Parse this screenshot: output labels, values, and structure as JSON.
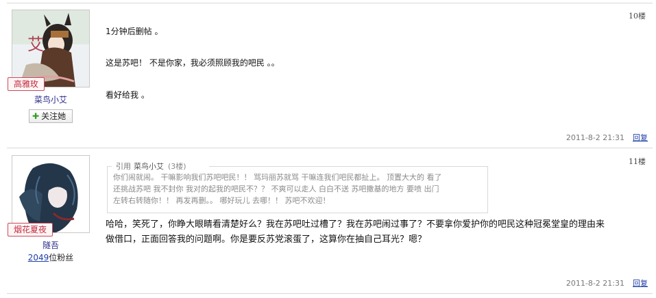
{
  "posts": [
    {
      "floor": "10楼",
      "user": {
        "name": "菜鸟小艾",
        "rank_badge": "高雅玫",
        "avatar_char": "艾",
        "follow_label": "关注她"
      },
      "content": {
        "lines": [
          "1分钟后删帖 。",
          "这是苏吧！ 不是你家，我必须照顾我的吧民 。。",
          "看好给我 。"
        ]
      },
      "time": "2011-8-2 21:31",
      "reply_label": "回复"
    },
    {
      "floor": "11楼",
      "user": {
        "name": "隧吾",
        "rank_badge": "烟花夏夜",
        "fans_count": "2049",
        "fans_suffix": "位粉丝"
      },
      "quote": {
        "prefix": "引用",
        "author": "菜鸟小艾",
        "floor": "(3楼)",
        "lines": [
          "你们闹就闹。 干嘛影响我们苏吧吧民！！ 骂玛丽苏就骂 干嘛连我们吧民都扯上。 顶置大大的 看了",
          "还挑战苏吧 我不封你 我对的起我的吧民不？？ 不爽可以走人 白白不送 苏吧撒基的地方 要喷 出门",
          "左转右转随你！！ 再发再删。。 哪好玩儿 去哪！！ 苏吧不欢迎！"
        ]
      },
      "content": {
        "lines": [
          "哈哈，笑死了，你睁大眼睛看清楚好么？我在苏吧吐过槽了？我在苏吧闹过事了？不要拿你爱护你的吧民这种冠冕堂皇的理由来",
          "做借口，正面回答我的问题啊。你是要反苏党滚蛋了，这算你在抽自己耳光？嗯？"
        ]
      },
      "time": "2011-8-2 21:31",
      "reply_label": "回复"
    }
  ],
  "colors": {
    "rank_badge": "#c0293d",
    "username": "#2a2a8a",
    "reply_link": "#1f3fa8",
    "divider": "#d8d8d8"
  }
}
